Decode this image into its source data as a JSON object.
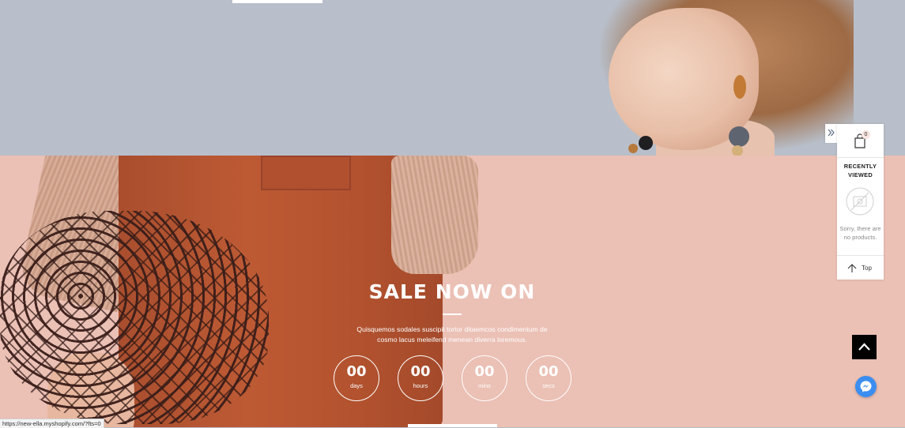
{
  "sale": {
    "title": "SALE NOW ON",
    "text": "Quisquemos sodales suscipit tortor ditaemcos condimentum de cosmo lacus meleifend menean diverra loremous.",
    "countdown": [
      {
        "value": "00",
        "label": "days"
      },
      {
        "value": "00",
        "label": "hours"
      },
      {
        "value": "00",
        "label": "mins"
      },
      {
        "value": "00",
        "label": "secs"
      }
    ]
  },
  "recently_viewed": {
    "cart_count": "0",
    "title_line1": "RECENTLY",
    "title_line2": "VIEWED",
    "empty_message": "Sorry, there are no products.",
    "top_label": "Top"
  },
  "status_bar": {
    "url": "https://new-ella.myshopify.com/?fts=0"
  },
  "colors": {
    "top_banner_bg": "#b8bfca",
    "sale_bg": "#ebc0b5",
    "messenger_blue": "#3b8ef0",
    "back_to_top_bg": "#000000"
  },
  "icons": [
    "double-chevron-right-icon",
    "shopping-bag-icon",
    "no-image-icon",
    "arrow-up-icon",
    "chevron-up-icon",
    "messenger-icon"
  ]
}
